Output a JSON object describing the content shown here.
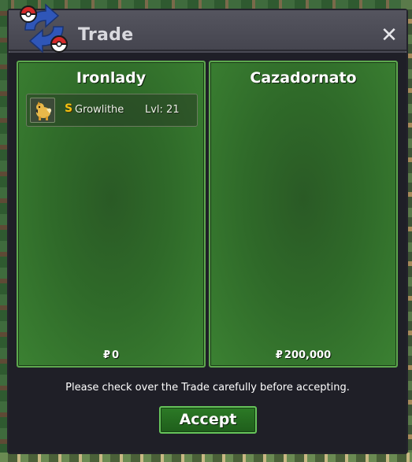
{
  "window": {
    "title": "Trade",
    "close_icon": "close-icon",
    "logo_icon": "trade-swap-logo-icon"
  },
  "left_panel": {
    "player_name": "Ironlady",
    "currency_symbol": "₽",
    "currency_amount": "0",
    "items": [
      {
        "icon": "growlithe-sprite-icon",
        "badge": "S",
        "name": "Growlithe",
        "level": "Lvl: 21"
      }
    ]
  },
  "right_panel": {
    "player_name": "Cazadornato",
    "currency_symbol": "₽",
    "currency_amount": "200,000",
    "items": []
  },
  "footer": {
    "notice": "Please check over the Trade carefully before accepting.",
    "accept_label": "Accept"
  },
  "colors": {
    "panel_green": "#2f6a29",
    "panel_border": "#5ea84e",
    "window_bg": "#4a4a55",
    "body_bg": "#1f1f27",
    "badge_gold": "#f2c011",
    "pokeball_red": "#d42a2a",
    "arrow_blue": "#2f56b8"
  }
}
